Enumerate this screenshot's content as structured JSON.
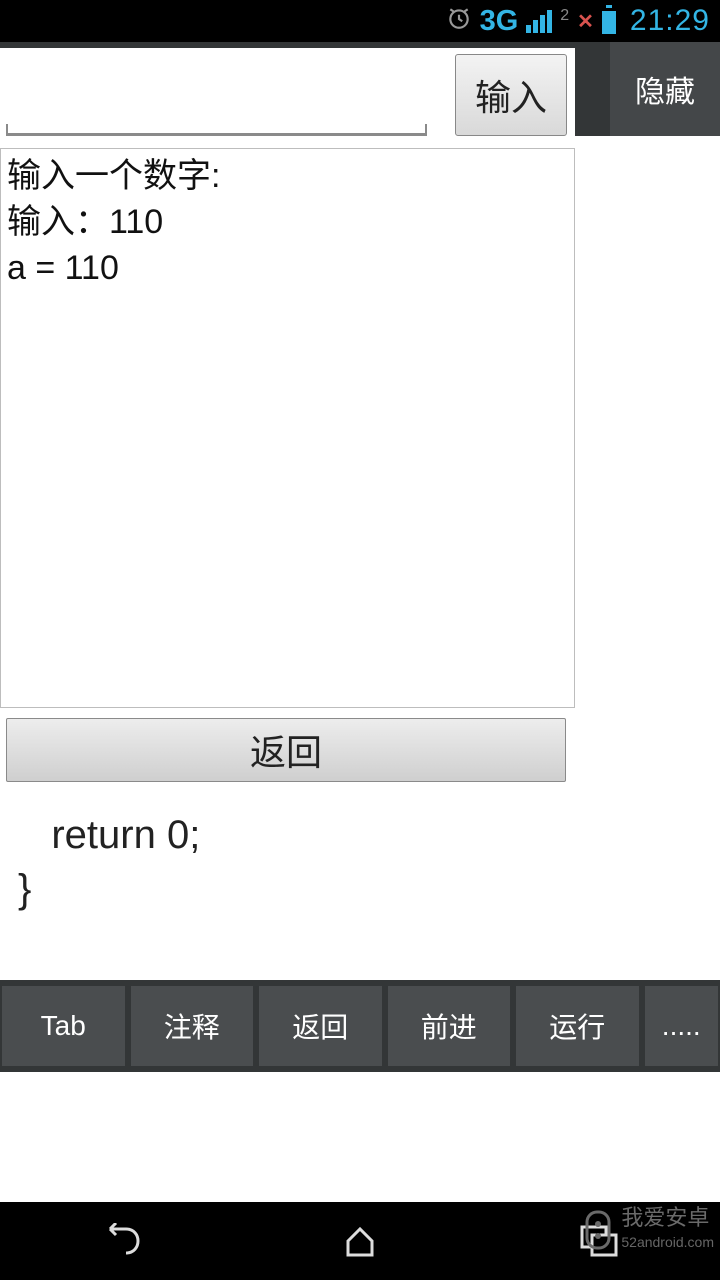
{
  "status": {
    "network": "3G",
    "time": "21:29"
  },
  "header": {
    "hide_label": "隐藏"
  },
  "panel": {
    "input_value": "",
    "input_button_label": "输入",
    "output_text": "输入一个数字:\n输入：110\na = 110",
    "return_button_label": "返回"
  },
  "code": {
    "text": "   return 0;\n}"
  },
  "toolbar": {
    "items": [
      "Tab",
      "注释",
      "返回",
      "前进",
      "运行",
      "....."
    ]
  },
  "watermark": {
    "title": "我爱安卓",
    "sub": "52android.com"
  }
}
